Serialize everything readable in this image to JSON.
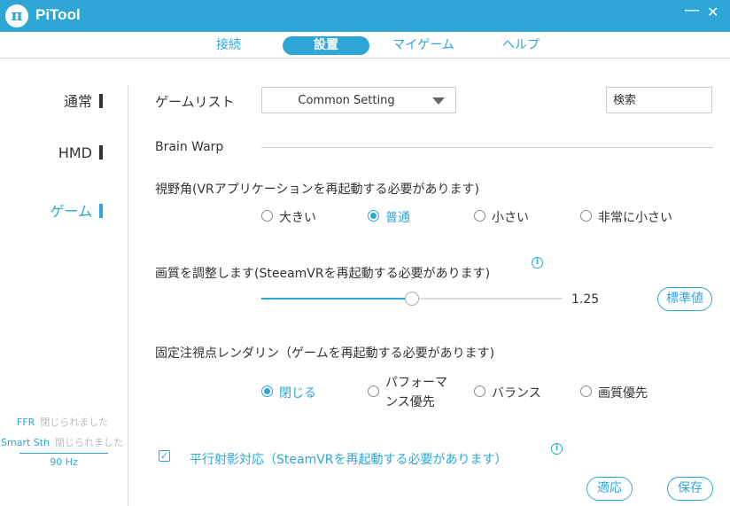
{
  "window": {
    "title": "PiTool",
    "logo_glyph": "π",
    "minimize_glyph": "—",
    "close_glyph": "✕"
  },
  "tabs": [
    {
      "label": "接続",
      "active": false
    },
    {
      "label": "設置",
      "active": true
    },
    {
      "label": "マイゲーム",
      "active": false
    },
    {
      "label": "ヘルプ",
      "active": false
    }
  ],
  "sidebar": {
    "items": [
      {
        "label": "通常",
        "active": false
      },
      {
        "label": "HMD",
        "active": false
      },
      {
        "label": "ゲーム",
        "active": true
      }
    ],
    "status": {
      "ffr_key": "FFR",
      "ffr_value": "閉じられました",
      "smart_key": "Smart Sth",
      "smart_value": "閉じられました",
      "refresh": "90 Hz"
    }
  },
  "main": {
    "game_list_label": "ゲームリスト",
    "game_select_value": "Common Setting",
    "search_placeholder": "検索",
    "section_title": "Brain Warp",
    "fov": {
      "label": "視野角(VRアプリケーションを再起動する必要があります)",
      "options": [
        "大きい",
        "普通",
        "小さい",
        "非常に小さい"
      ],
      "selected": "普通"
    },
    "quality": {
      "label": "画質を調整します(SteeamVRを再起動する必要があります)",
      "value": "1.25",
      "slider_fraction": 0.5,
      "reset_button": "標準値"
    },
    "foveated": {
      "label": "固定注視点レンダリン（ゲームを再起動する必要があります)",
      "options": [
        "閉じる",
        "パフォーマンス優先",
        "バランス",
        "画質優先"
      ],
      "option_line1": "パフォーマ",
      "option_line2": "ンス優先",
      "selected": "閉じる"
    },
    "parallel": {
      "label": "平行射影対応（SteamVRを再起動する必要があります）",
      "checked": true
    },
    "apply_button": "適応",
    "save_button": "保存"
  },
  "colors": {
    "accent": "#2ea7d7",
    "text": "#333333",
    "border": "#cccccc"
  }
}
